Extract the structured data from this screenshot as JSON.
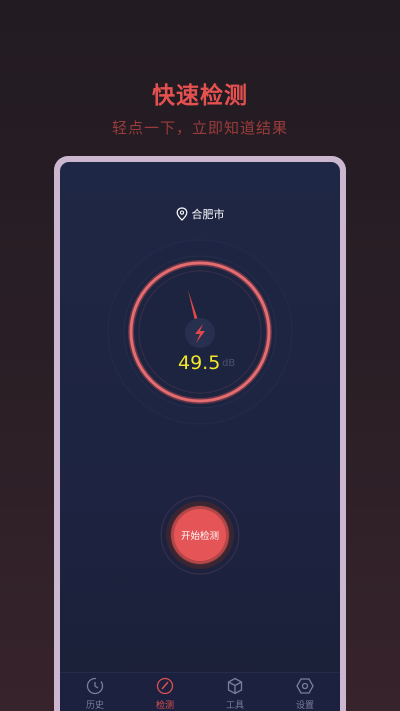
{
  "hero": {
    "title": "快速检测",
    "subtitle": "轻点一下，立即知道结果"
  },
  "location": {
    "icon": "location-pin-icon",
    "city": "合肥市"
  },
  "meter": {
    "value": "49.5",
    "unit": "dB",
    "icon": "lightning-icon",
    "needle_icon": "needle-icon"
  },
  "start_button": {
    "label": "开始检测"
  },
  "tabs": [
    {
      "label": "历史",
      "icon": "history-icon",
      "active": false
    },
    {
      "label": "检测",
      "icon": "gauge-icon",
      "active": true
    },
    {
      "label": "工具",
      "icon": "cube-icon",
      "active": false
    },
    {
      "label": "设置",
      "icon": "hex-settings-icon",
      "active": false
    }
  ],
  "colors": {
    "accent": "#e4514f",
    "reading": "#f2e52c",
    "screen_bg": "#1e2745",
    "frame": "#cbb7cf"
  }
}
